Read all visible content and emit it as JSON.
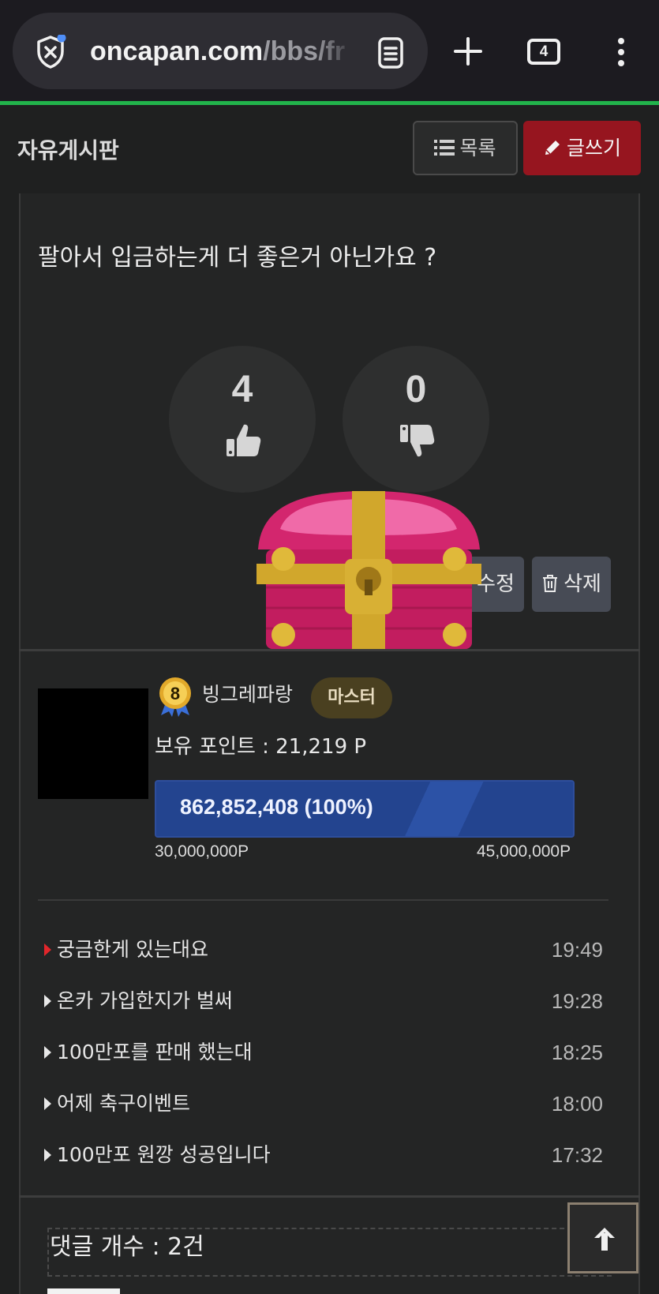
{
  "browser": {
    "url_host": "oncapan.com",
    "url_path": "/bbs/fr",
    "tab_count": "4",
    "icons": [
      "shield-x-icon",
      "reader-mode-icon",
      "plus-icon",
      "tabs-icon",
      "kebab-menu-icon"
    ],
    "accent": "#22b34b"
  },
  "board": {
    "title": "자유게시판",
    "list_label": "목록",
    "write_label": "글쓰기",
    "write_color": "#96151f"
  },
  "post": {
    "title": "팔아서 입금하는게 더 좋은거 아닌가요 ?",
    "likes": "4",
    "dislikes": "0",
    "edit_label": "수정",
    "delete_label": "삭제"
  },
  "author": {
    "level": "8",
    "nickname": "빙그레파랑",
    "rank": "마스터",
    "points": "보유 포인트 : 21,219 P",
    "xp_text": "862,852,408 (100%)",
    "xp_progress": 1.0,
    "xp_min": "30,000,000P",
    "xp_max": "45,000,000P"
  },
  "related_posts": [
    {
      "title": "궁금한게 있는대요",
      "time": "19:49"
    },
    {
      "title": "온카 가입한지가 벌써",
      "time": "19:28"
    },
    {
      "title": "100만포를 판매 했는대",
      "time": "18:25"
    },
    {
      "title": "어제 축구이벤트",
      "time": "18:00"
    },
    {
      "title": "100만포 원깡 성공입니다",
      "time": "17:32"
    }
  ],
  "comments": {
    "count_label": "댓글 개수 : 2건"
  }
}
